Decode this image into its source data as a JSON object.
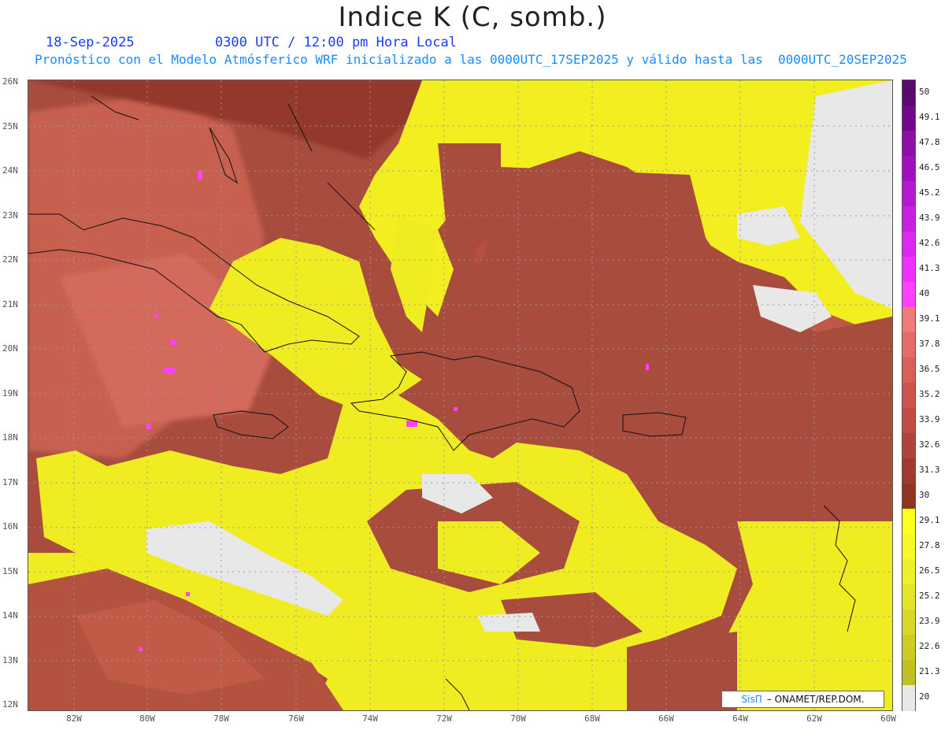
{
  "header": {
    "title": "Indice K (C, somb.)",
    "date": "18-Sep-2025",
    "time": "0300 UTC / 12:00 pm Hora Local",
    "model_line": "Pronóstico con el Modelo Atmósferico WRF inicializado a las 0000UTC_17SEP2025 y válido hasta las  0000UTC_20SEP2025"
  },
  "axes": {
    "lat_labels": [
      "26N",
      "25N",
      "24N",
      "23N",
      "22N",
      "21N",
      "20N",
      "19N",
      "18N",
      "17N",
      "16N",
      "15N",
      "14N",
      "13N",
      "12N"
    ],
    "lon_labels": [
      "82W",
      "80W",
      "78W",
      "76W",
      "74W",
      "72W",
      "70W",
      "68W",
      "66W",
      "64W",
      "62W",
      "60W"
    ]
  },
  "colorbar": {
    "labels": [
      "50",
      "49.1",
      "47.8",
      "46.5",
      "45.2",
      "43.9",
      "42.6",
      "41.3",
      "40",
      "39.1",
      "37.8",
      "36.5",
      "35.2",
      "33.9",
      "32.6",
      "31.3",
      "30",
      "29.1",
      "27.8",
      "26.5",
      "25.2",
      "23.9",
      "22.6",
      "21.3",
      "20"
    ],
    "colors": [
      "#5a0a6e",
      "#6e0a8a",
      "#8a10a8",
      "#a010c0",
      "#b418d0",
      "#c820e0",
      "#dc28f0",
      "#f030ff",
      "#ff40ff",
      "#f07a76",
      "#e46c66",
      "#d86058",
      "#cc564c",
      "#c04c42",
      "#b0433a",
      "#a03a30",
      "#8e3420",
      "#ffff20",
      "#f8f826",
      "#f0f02a",
      "#e4e42a",
      "#d8d82a",
      "#cccc26",
      "#c0c022",
      "#e8e8e8"
    ],
    "color_names": [
      "purple",
      "purple",
      "purple",
      "magenta",
      "magenta",
      "magenta",
      "magenta",
      "magenta",
      "magenta",
      "salmon",
      "salmon",
      "salmon",
      "red-brown",
      "red-brown",
      "red-brown",
      "red-brown",
      "brown",
      "yellow",
      "yellow",
      "yellow",
      "yellow",
      "olive-yellow",
      "olive-yellow",
      "olive",
      "light-gray"
    ]
  },
  "credit": {
    "sis": "SisΠ",
    "org": "– ONAMET/REP.DOM."
  }
}
